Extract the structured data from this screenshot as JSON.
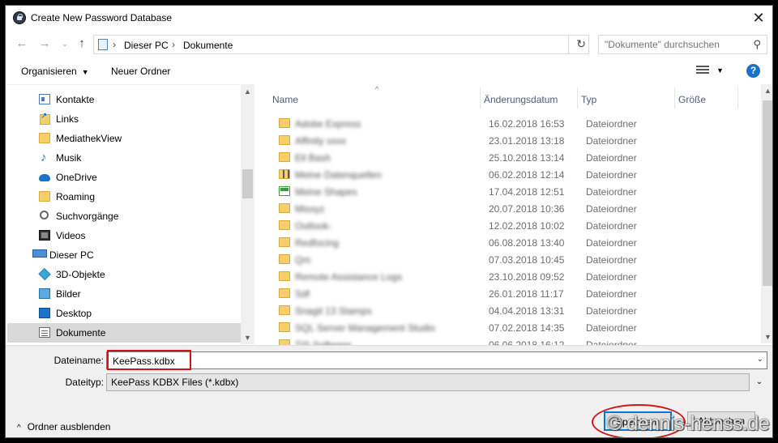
{
  "window": {
    "title": "Create New Password Database",
    "close_glyph": "✕"
  },
  "navigation": {
    "back_glyph": "←",
    "forward_glyph": "→",
    "recent_glyph": "⌄",
    "up_glyph": "↑",
    "breadcrumb": [
      "Dieser PC",
      "Dokumente"
    ],
    "separator": "›",
    "refresh_glyph": "↻",
    "search_placeholder": "\"Dokumente\" durchsuchen",
    "search_glyph": "⚲"
  },
  "toolbar": {
    "organize_label": "Organisieren",
    "organize_caret": "▼",
    "new_folder_label": "Neuer Ordner",
    "view_caret": "▼",
    "help_label": "?"
  },
  "nav_pane": {
    "items": [
      {
        "label": "Kontakte",
        "icon": "contacts-icon"
      },
      {
        "label": "Links",
        "icon": "links-icon"
      },
      {
        "label": "MediathekView",
        "icon": "folder-icon"
      },
      {
        "label": "Musik",
        "icon": "music-icon"
      },
      {
        "label": "OneDrive",
        "icon": "onedrive-icon"
      },
      {
        "label": "Roaming",
        "icon": "folder-icon"
      },
      {
        "label": "Suchvorgänge",
        "icon": "search-icon"
      },
      {
        "label": "Videos",
        "icon": "video-icon"
      },
      {
        "label": "Dieser PC",
        "icon": "computer-icon"
      },
      {
        "label": "3D-Objekte",
        "icon": "3d-objects-icon"
      },
      {
        "label": "Bilder",
        "icon": "pictures-icon"
      },
      {
        "label": "Desktop",
        "icon": "desktop-icon"
      },
      {
        "label": "Dokumente",
        "icon": "documents-icon",
        "selected": true
      }
    ],
    "scroll_up": "▲",
    "scroll_down": "▼"
  },
  "file_list": {
    "columns": [
      "Name",
      "Änderungsdatum",
      "Typ",
      "Größe"
    ],
    "sort_caret": "^",
    "rows": [
      {
        "name": "Adobe Express",
        "date": "16.02.2018 16:53",
        "type": "Dateiordner",
        "icon": "folder"
      },
      {
        "name": "Affinity xxxx",
        "date": "23.01.2018 13:18",
        "type": "Dateiordner",
        "icon": "folder"
      },
      {
        "name": "Ell Bash",
        "date": "25.10.2018 13:14",
        "type": "Dateiordner",
        "icon": "folder"
      },
      {
        "name": "Meine Datenquellen",
        "date": "06.02.2018 12:14",
        "type": "Dateiordner",
        "icon": "zip"
      },
      {
        "name": "Meine Shapes",
        "date": "17.04.2018 12:51",
        "type": "Dateiordner",
        "icon": "sheet"
      },
      {
        "name": "Misxyz",
        "date": "20.07.2018 10:36",
        "type": "Dateiordner",
        "icon": "folder"
      },
      {
        "name": "Outlook-",
        "date": "12.02.2018 10:02",
        "type": "Dateiordner",
        "icon": "folder"
      },
      {
        "name": "Redfocing",
        "date": "06.08.2018 13:40",
        "type": "Dateiordner",
        "icon": "folder"
      },
      {
        "name": "Qm",
        "date": "07.03.2018 10:45",
        "type": "Dateiordner",
        "icon": "folder"
      },
      {
        "name": "Remote Assistance Logs",
        "date": "23.10.2018 09:52",
        "type": "Dateiordner",
        "icon": "folder"
      },
      {
        "name": "Sdf",
        "date": "26.01.2018 11:17",
        "type": "Dateiordner",
        "icon": "folder"
      },
      {
        "name": "Snagit 13 Stamps",
        "date": "04.04.2018 13:31",
        "type": "Dateiordner",
        "icon": "folder"
      },
      {
        "name": "SQL Server Management Studio",
        "date": "07.02.2018 14:35",
        "type": "Dateiordner",
        "icon": "folder"
      },
      {
        "name": "TIS Software",
        "date": "06.06.2018 16:12",
        "type": "Dateiordner",
        "icon": "folder"
      }
    ],
    "scroll_up": "▲",
    "scroll_down": "▼"
  },
  "save_form": {
    "filename_label": "Dateiname:",
    "filename_value": "KeePass.kdbx",
    "filetype_label": "Dateityp:",
    "filetype_value": "KeePass KDBX Files (*.kdbx)",
    "dropdown_glyph": "⌄",
    "hide_folders_glyph": "^",
    "hide_folders_label": "Ordner ausblenden",
    "save_button": "Speichern",
    "cancel_button": "Abbrechen",
    "watermark": "© dennis-henss.de"
  },
  "colors": {
    "selected_row": "#d9d9d9",
    "highlight": "#d41414",
    "accent": "#0078d7"
  }
}
